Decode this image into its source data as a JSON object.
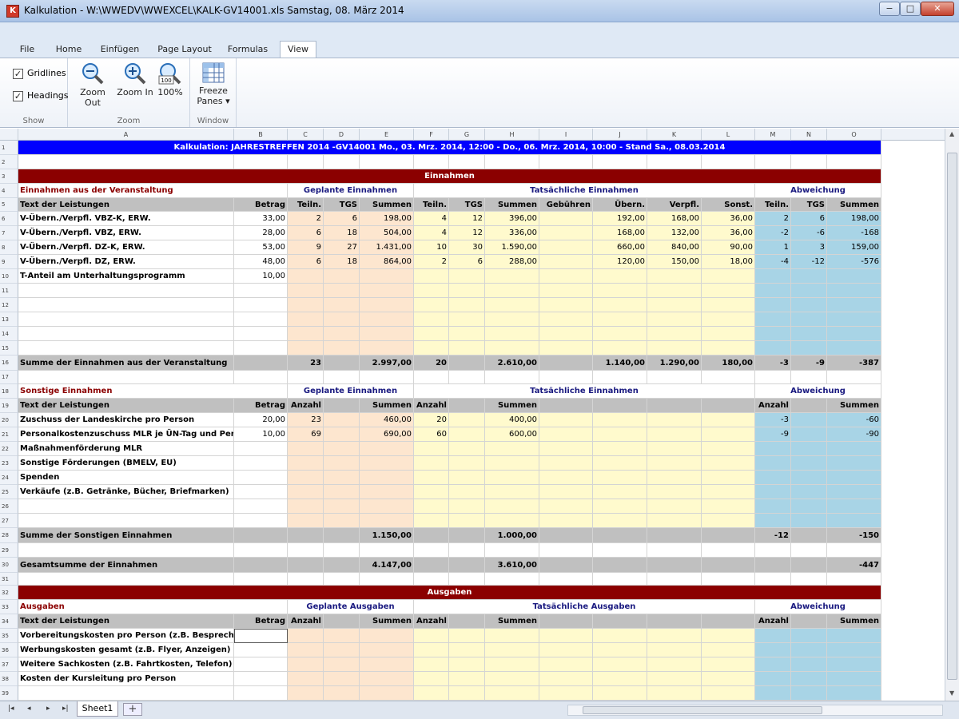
{
  "window": {
    "title": "Kalkulation - W:\\WWEDV\\WWEXCEL\\KALK-GV14001.xls  Samstag, 08. März 2014",
    "min": "−",
    "max": "□",
    "close": "✕"
  },
  "tabs": [
    "File",
    "Home",
    "Einfügen",
    "Page Layout",
    "Formulas",
    "View"
  ],
  "ribbon": {
    "show": {
      "gridlines": "Gridlines",
      "headings": "Headings",
      "label": "Show",
      "check": "✓"
    },
    "zoom": {
      "out": "Zoom Out",
      "in": "Zoom In",
      "pct": "100%",
      "label": "Zoom",
      "pct_badge": "100"
    },
    "window": {
      "freeze_line1": "Freeze",
      "freeze_line2": "Panes ▾",
      "label": "Window"
    }
  },
  "columns": [
    "A",
    "B",
    "C",
    "D",
    "E",
    "F",
    "G",
    "H",
    "I",
    "J",
    "K",
    "L",
    "M",
    "N",
    "O"
  ],
  "sheet": {
    "banner": "Kalkulation: JAHRESTREFFEN 2014 -GV14001   Mo., 03. Mrz. 2014, 12:00  -  Do., 06. Mrz. 2014, 10:00 - Stand Sa., 08.03.2014",
    "einnahmen": "Einnahmen",
    "ausgaben": "Ausgaben",
    "sec1_title": "Einnahmen aus der Veranstaltung",
    "geplante_einnahmen": "Geplante Einnahmen",
    "tats_einnahmen": "Tatsächliche Einnahmen",
    "abweichung": "Abweichung",
    "text_der_leistungen": "Text der Leistungen",
    "betrag": "Betrag",
    "teiln": "Teiln.",
    "tgs": "TGS",
    "summen": "Summen",
    "gebuehren": "Gebühren",
    "uebern": "Übern.",
    "verpfl": "Verpfl.",
    "sonst": "Sonst.",
    "anzahl": "Anzahl",
    "rows1": [
      {
        "label": "V-Übern./Verpfl. VBZ-K, ERW.",
        "betrag": "33,00",
        "pt": "2",
        "ptgs": "6",
        "ps": "198,00",
        "tt": "4",
        "ttgs": "12",
        "ts": "396,00",
        "ue": "192,00",
        "vp": "168,00",
        "so": "36,00",
        "at": "2",
        "atgs": "6",
        "as": "198,00"
      },
      {
        "label": "V-Übern./Verpfl. VBZ, ERW.",
        "betrag": "28,00",
        "pt": "6",
        "ptgs": "18",
        "ps": "504,00",
        "tt": "4",
        "ttgs": "12",
        "ts": "336,00",
        "ue": "168,00",
        "vp": "132,00",
        "so": "36,00",
        "at": "-2",
        "atgs": "-6",
        "as": "-168"
      },
      {
        "label": "V-Übern./Verpfl. DZ-K, ERW.",
        "betrag": "53,00",
        "pt": "9",
        "ptgs": "27",
        "ps": "1.431,00",
        "tt": "10",
        "ttgs": "30",
        "ts": "1.590,00",
        "ue": "660,00",
        "vp": "840,00",
        "so": "90,00",
        "at": "1",
        "atgs": "3",
        "as": "159,00"
      },
      {
        "label": "V-Übern./Verpfl. DZ, ERW.",
        "betrag": "48,00",
        "pt": "6",
        "ptgs": "18",
        "ps": "864,00",
        "tt": "2",
        "ttgs": "6",
        "ts": "288,00",
        "ue": "120,00",
        "vp": "150,00",
        "so": "18,00",
        "at": "-4",
        "atgs": "-12",
        "as": "-576"
      },
      {
        "label": "T-Anteil am Unterhaltungsprogramm",
        "betrag": "10,00",
        "pt": "",
        "ptgs": "",
        "ps": "",
        "tt": "",
        "ttgs": "",
        "ts": "",
        "ue": "",
        "vp": "",
        "so": "",
        "at": "",
        "atgs": "",
        "as": ""
      }
    ],
    "sum1": {
      "label": "Summe der Einnahmen aus der Veranstaltung",
      "pt": "23",
      "ps": "2.997,00",
      "tt": "20",
      "ts": "2.610,00",
      "ue": "1.140,00",
      "vp": "1.290,00",
      "so": "180,00",
      "at": "-3",
      "atgs": "-9",
      "as": "-387"
    },
    "sec2_title": "Sonstige Einnahmen",
    "rows2": [
      {
        "label": "Zuschuss der Landeskirche pro Person",
        "betrag": "20,00",
        "pa": "23",
        "ps": "460,00",
        "ta": "20",
        "ts": "400,00",
        "aa": "-3",
        "as": "-60"
      },
      {
        "label": "Personalkostenzuschuss MLR je ÜN-Tag und Person",
        "betrag": "10,00",
        "pa": "69",
        "ps": "690,00",
        "ta": "60",
        "ts": "600,00",
        "aa": "-9",
        "as": "-90"
      },
      {
        "label": "Maßnahmenförderung MLR",
        "betrag": "",
        "pa": "",
        "ps": "",
        "ta": "",
        "ts": "",
        "aa": "",
        "as": ""
      },
      {
        "label": "Sonstige Förderungen (BMELV, EU)",
        "betrag": "",
        "pa": "",
        "ps": "",
        "ta": "",
        "ts": "",
        "aa": "",
        "as": ""
      },
      {
        "label": "Spenden",
        "betrag": "",
        "pa": "",
        "ps": "",
        "ta": "",
        "ts": "",
        "aa": "",
        "as": ""
      },
      {
        "label": "Verkäufe (z.B. Getränke, Bücher, Briefmarken)",
        "betrag": "",
        "pa": "",
        "ps": "",
        "ta": "",
        "ts": "",
        "aa": "",
        "as": ""
      }
    ],
    "sum2": {
      "label": "Summe der Sonstigen Einnahmen",
      "ps": "1.150,00",
      "ts": "1.000,00",
      "aa": "-12",
      "as": "-150"
    },
    "gesamt": {
      "label": "Gesamtsumme der Einnahmen",
      "ps": "4.147,00",
      "ts": "3.610,00",
      "as": "-447"
    },
    "sec3_title": "Ausgaben",
    "geplante_ausgaben": "Geplante Ausgaben",
    "tats_ausgaben": "Tatsächliche Ausgaben",
    "rows3": [
      "Vorbereitungskosten pro Person (z.B. Besprechungen)",
      "Werbungskosten gesamt (z.B. Flyer, Anzeigen)",
      "Weitere Sachkosten (z.B. Fahrtkosten, Telefon)",
      "Kosten der Kursleitung pro Person"
    ]
  },
  "bottom": {
    "sheet": "Sheet1",
    "add": "+",
    "first": "|◂",
    "prev": "◂",
    "next": "▸",
    "last": "▸|"
  },
  "colors": {
    "blue_banner": "#0000ff",
    "red_banner": "#8b0000",
    "peach": "#fde6cf",
    "yellow": "#fffacd",
    "blue": "#a8d4e6",
    "gray": "#c0c0c0"
  }
}
